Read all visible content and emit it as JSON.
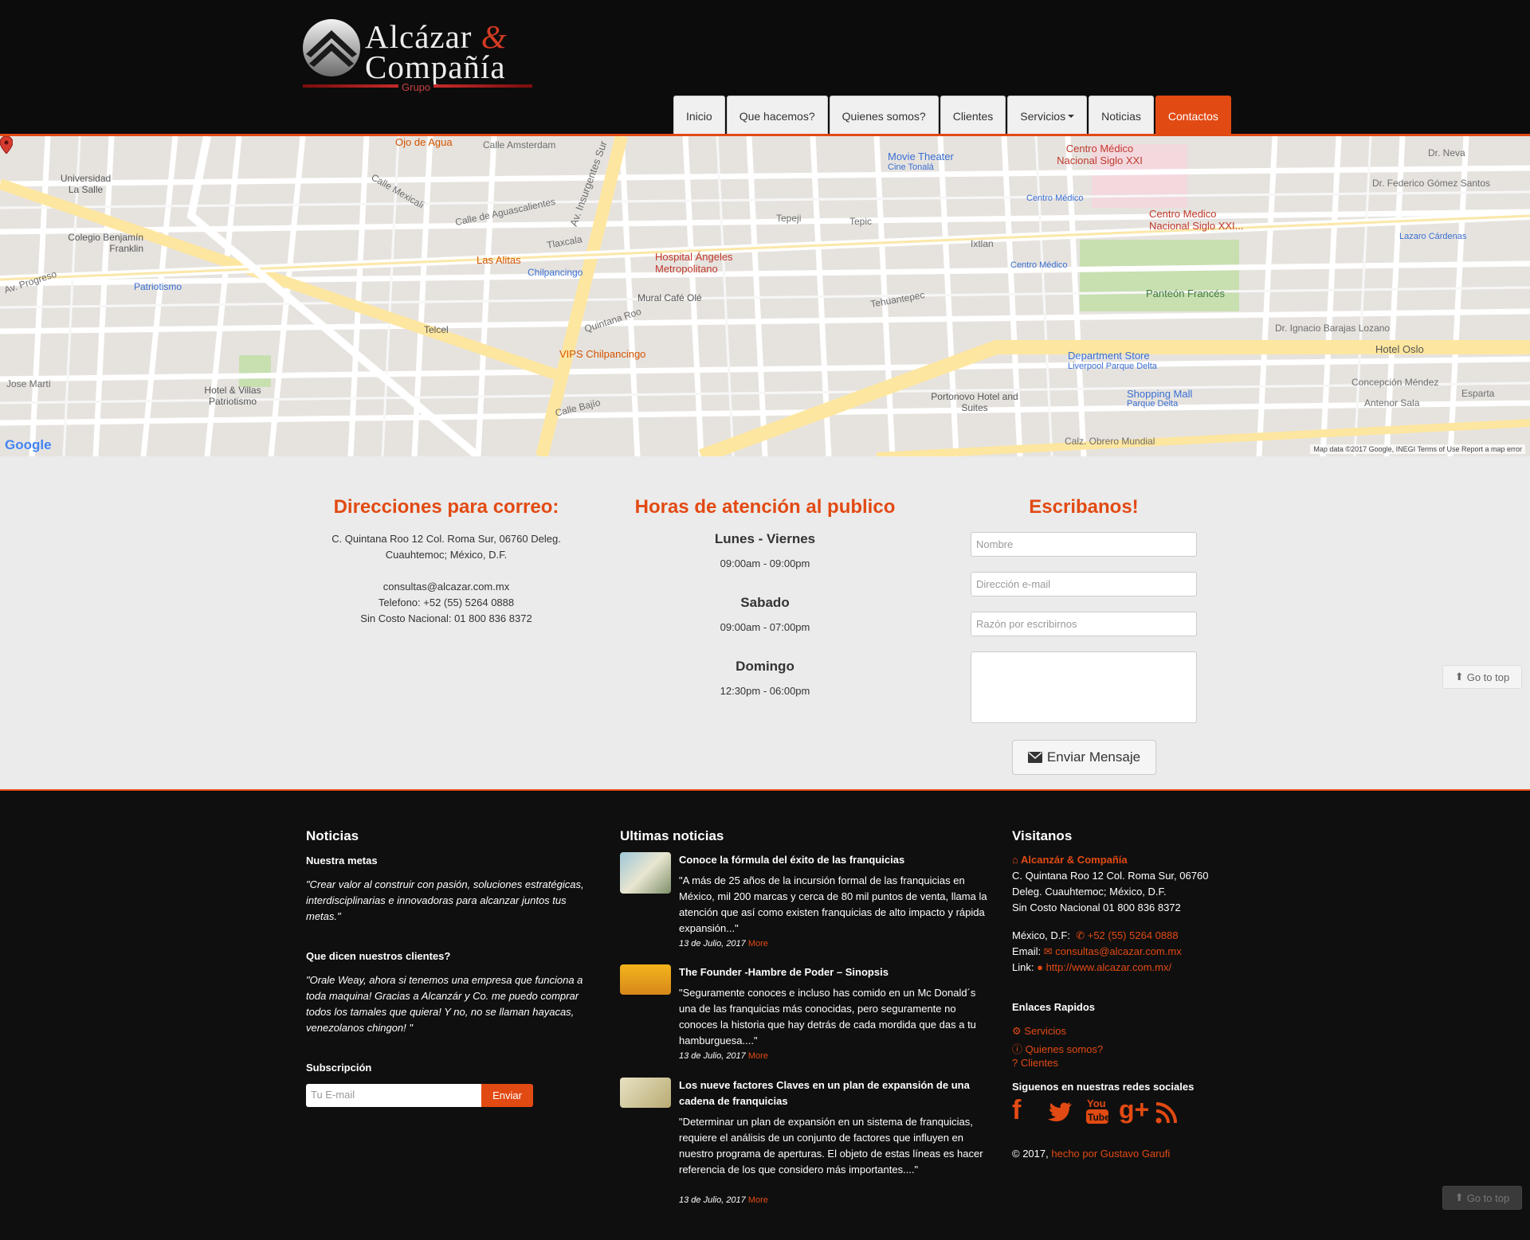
{
  "brand": {
    "line1": "Alcázar",
    "amp": "&",
    "line2": "Compañía",
    "sub": "Grupo",
    "accent": "#e24a13"
  },
  "nav": {
    "items": [
      {
        "label": "Inicio"
      },
      {
        "label": "Que hacemos?"
      },
      {
        "label": "Quienes somos?"
      },
      {
        "label": "Clientes"
      },
      {
        "label": "Servicios"
      },
      {
        "label": "Noticias"
      },
      {
        "label": "Contactos"
      }
    ],
    "active": "Contactos"
  },
  "map": {
    "labels": {
      "universidad": "Universidad La Salle",
      "colegio": "Colegio Benjamín Franklin",
      "patriotismo": "Patriotismo",
      "ojo_agua": "Ojo de Agua",
      "las_alitas": "Las Alitas",
      "chilpancingo": "Chilpancingo",
      "telcel": "Telcel",
      "vips": "VIPS Chilpancingo",
      "hotel_villas": "Hotel & Villas Patriotismo",
      "hospital": "Hospital Ángeles Metropolitano",
      "mural": "Mural Café Olé",
      "movie": "Movie Theater",
      "movie_sub": "Cine Tonalá",
      "centro_medico": "Centro Médico Nacional Siglo XXI",
      "centro_medico2": "Centro Medico Nacional Siglo XXI...",
      "centro_medico_metro": "Centro Médico",
      "panteon": "Panteón Francés",
      "lazaro": "Lazaro Cárdenas",
      "dept_store": "Department Store",
      "liverpool": "Liverpool Parque Delta",
      "shopping": "Shopping Mall",
      "parque_delta": "Parque Delta",
      "portonovo": "Portonovo Hotel and Suites",
      "hotel_oslo": "Hotel Oslo",
      "insurgentes": "Av. Insurgentes Sur",
      "obrero": "Calz. Obrero Mundial",
      "tehuantepec": "Tehuantepec",
      "quintana": "Quintana Roo",
      "aguascalientes": "Calle de Aguascalientes",
      "tlaxcala": "Tlaxcala",
      "progreso": "Av. Progreso",
      "ixtlan": "Ixtlan",
      "tepeji": "Tepeji",
      "tepic": "Tepic",
      "dr_neva": "Dr. Neva",
      "gomez": "Dr. Federico Gómez Santos",
      "barajas": "Dr. Ignacio Barajas Lozano",
      "concepcion": "Concepción Méndez",
      "antenor": "Antenor Sala",
      "esparta": "Esparta",
      "jose_marti": "Jose Martí",
      "amsterdam": "Calle Amsterdam",
      "bajio": "Calle Bajío",
      "mexicali": "Calle Mexicali"
    },
    "google": "Google",
    "footer": "Map data ©2017 Google, INEGI   Terms of Use   Report a map error"
  },
  "contact": {
    "addr_title": "Direcciones para correo:",
    "addr_line1": "C. Quintana Roo 12 Col. Roma Sur, 06760 Deleg.",
    "addr_line2": "Cuauhtemoc; México, D.F.",
    "email": "consultas@alcazar.com.mx",
    "phone": "Telefono: +52 (55) 5264 0888",
    "toll": "Sin Costo Nacional: 01 800 836 8372",
    "hours_title": "Horas de atención al publico",
    "hours": [
      {
        "day": "Lunes - Viernes",
        "time": "09:00am - 09:00pm"
      },
      {
        "day": "Sabado",
        "time": "09:00am - 07:00pm"
      },
      {
        "day": "Domingo",
        "time": "12:30pm - 06:00pm"
      }
    ],
    "form_title": "Escribanos!",
    "name_placeholder": "Nombre",
    "email_placeholder": "Dirección e-mail",
    "reason_placeholder": "Razón por escribirnos",
    "send_label": "Enviar Mensaje",
    "goto_top": "Go to top"
  },
  "footer": {
    "news_heading": "Noticias",
    "metas_title": "Nuestra metas",
    "metas_quote": "\"Crear valor al construir con pasión, soluciones estratégicas, interdisciplinarias e innovadoras para alcanzar juntos tus metas.\"",
    "clients_title": "Que dicen nuestros clientes?",
    "clients_quote": "\"Orale Weay, ahora si tenemos una empresa que funciona a toda maquina! Gracias a Alcanzár y Co. me puedo comprar todos los tamales que quiera! Y no, no se llaman hayacas, venezolanos chingon! \"",
    "subscription_title": "Subscripción",
    "sub_placeholder": "Tu E-mail",
    "sub_button": "Enviar",
    "latest_heading": "Ultimas noticias",
    "articles": [
      {
        "title": "Conoce la fórmula del éxito de las franquicias",
        "body": "\"A más de 25 años de la incursión formal de las franquicias en México, mil 200 marcas y cerca de 80 mil puntos de venta, llama la atención que así como existen franquicias de alto impacto y rápida expansión...\"",
        "date": "13 de Julio, 2017",
        "more": "More"
      },
      {
        "title": "The Founder -Hambre de Poder – Sinopsis",
        "body": "\"Seguramente conoces e incluso has comido en un Mc Donald´s una de las franquicias más conocidas, pero seguramente no conoces la historia que hay detrás de cada mordida que das a tu hamburguesa....\"",
        "date": "13 de Julio, 2017",
        "more": "More"
      },
      {
        "title": "Los nueve factores Claves en un plan de expansión de una cadena de franquicias",
        "body": "\"Determinar un plan de expansión en un sistema de franquicias, requiere el análisis de un conjunto de factores que influyen en nuestro programa de aperturas. El objeto de estas líneas es hacer referencia de los que considero más importantes....\"",
        "date": "13 de Julio, 2017",
        "more": "More"
      }
    ],
    "visit_heading": "Visitanos",
    "visit_brand": "Alcanzár & Compañía",
    "visit_addr1": "C. Quintana Roo 12 Col. Roma Sur, 06760",
    "visit_addr2": "Deleg. Cuauhtemoc; México, D.F.",
    "visit_toll": "Sin Costo Nacional 01 800 836 8372",
    "visit_city": "México, D.F:",
    "visit_phone": "+52 (55) 5264 0888",
    "visit_email_label": "Email:",
    "visit_email": "consultas@alcazar.com.mx",
    "visit_link_label": "Link:",
    "visit_link": "http://www.alcazar.com.mx/",
    "quick_heading": "Enlaces Rapidos",
    "quick_links": [
      "Servicios",
      "Quienes somos?",
      "Clientes"
    ],
    "social_heading": "Siguenos en nuestras redes sociales",
    "social_icons": [
      "facebook-icon",
      "twitter-icon",
      "youtube-icon",
      "google-plus-icon",
      "rss-icon"
    ],
    "copyright": "© 2017,",
    "credit": "hecho por Gustavo Garufi"
  }
}
